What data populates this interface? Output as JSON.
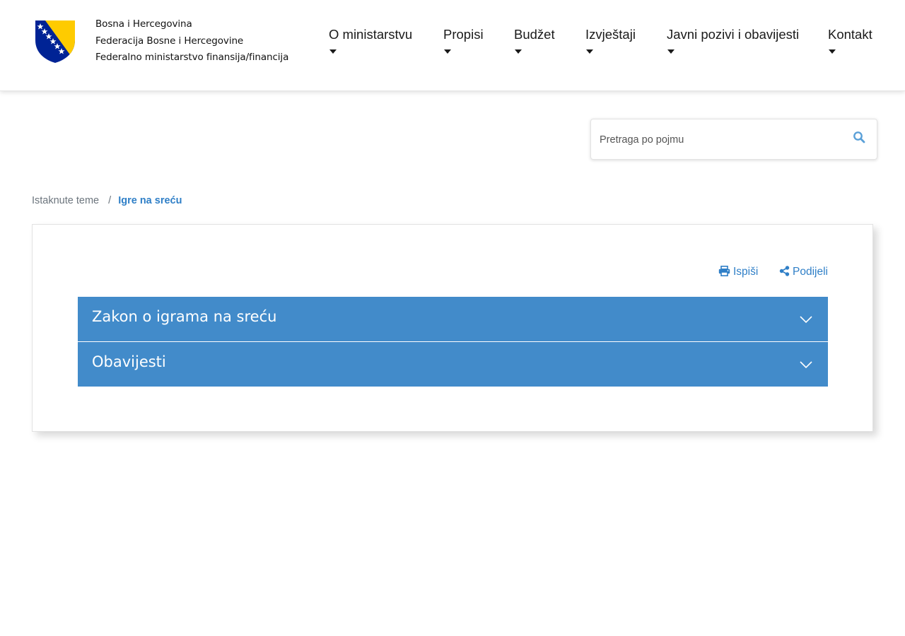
{
  "header": {
    "brand_lines": [
      "Bosna i Hercegovina",
      "Federacija Bosne i Hercegovine",
      "Federalno ministarstvo finansija/financija"
    ]
  },
  "nav": {
    "items": [
      {
        "label": "O ministarstvu"
      },
      {
        "label": "Propisi"
      },
      {
        "label": "Budžet"
      },
      {
        "label": "Izvještaji"
      },
      {
        "label": "Javni pozivi i obavijesti"
      },
      {
        "label": "Kontakt"
      }
    ]
  },
  "search": {
    "placeholder": "Pretraga po pojmu",
    "value": "",
    "icon": "search-icon"
  },
  "breadcrumb": {
    "items": [
      "Istaknute teme",
      "Igre na sreću"
    ],
    "separator": "/"
  },
  "card": {
    "print_label": "Ispiši",
    "share_label": "Podijeli",
    "accordion": [
      {
        "title": "Zakon o igrama na sreću",
        "expanded": false
      },
      {
        "title": "Obavijesti",
        "expanded": false
      }
    ]
  },
  "colors": {
    "accent": "#428bca",
    "link": "#2f7fc7",
    "flag_blue": "#002395",
    "flag_yellow": "#fecb00"
  }
}
